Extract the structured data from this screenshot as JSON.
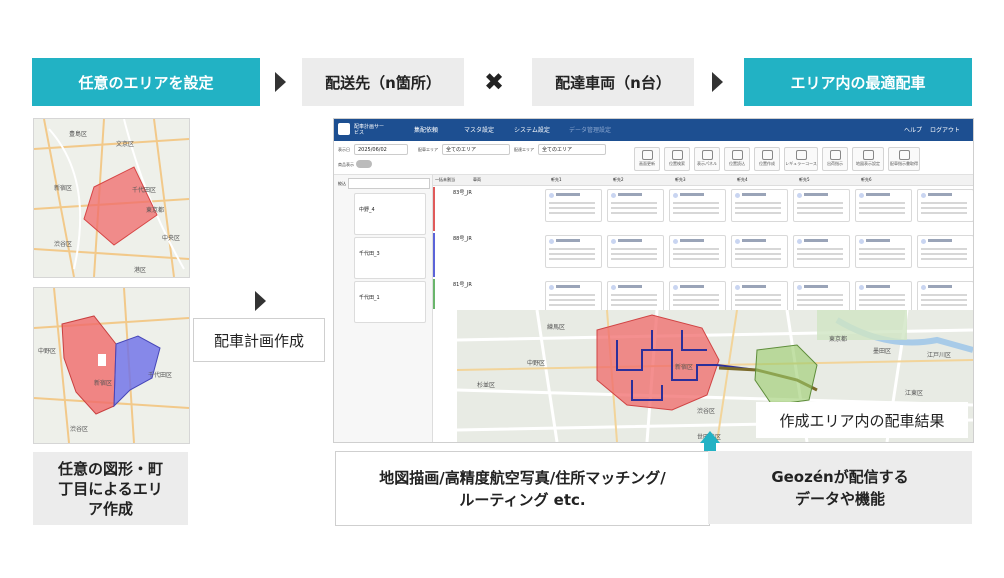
{
  "flow": {
    "step1": "任意のエリアを設定",
    "step2": "配送先（n箇所）",
    "step3": "配達車両（n台）",
    "step4": "エリア内の最適配車",
    "times": "✖"
  },
  "left": {
    "map1_wards": [
      "豊島区",
      "文京区",
      "新宿区",
      "千代田区",
      "東京都",
      "渋谷区",
      "中央区",
      "港区"
    ],
    "map2_wards": [
      "中野区",
      "新宿区",
      "千代田区",
      "渋谷区"
    ],
    "caption": "任意の図形・町丁目によるエリア作成"
  },
  "middle": {
    "plan_label": "配車計画作成"
  },
  "app": {
    "title": "配車計画サービス",
    "menu": [
      "集配依頼",
      "マスタ設定",
      "システム設定",
      "データ管理設定"
    ],
    "help": "ヘルプ",
    "logout": "ログアウト",
    "date_label": "表示日",
    "date_value": "2025/06/02",
    "area_label": "配車エリア",
    "area_value": "全てのエリア",
    "delivery_area_label": "配達エリア",
    "delivery_area_value": "全てのエリア",
    "toggle_label": "商品表示",
    "tools": [
      "画面更新",
      "位置検索",
      "表示パネル",
      "位置読込",
      "位置作成",
      "レギュラーコース",
      "出荷指示",
      "地図表示設定",
      "配車指示書取得"
    ],
    "col_headers": [
      "一括未割当",
      "車両",
      "",
      "軒先1",
      "軒先2",
      "軒先3",
      "軒先4",
      "軒先5",
      "軒先6"
    ],
    "vehicles": [
      "83号_JR",
      "88号_JR",
      "81号_JR"
    ],
    "side_cards": [
      "中野_4",
      "千代田_3",
      "千代田_1"
    ],
    "map_places": [
      "東京都",
      "新宿区",
      "渋谷区",
      "墨田区",
      "江戸川区",
      "江東区",
      "練馬区",
      "中野区",
      "杉並区",
      "世田谷区"
    ]
  },
  "result_label": "作成エリア内の配車結果",
  "bottom": {
    "left_text": "地図描画/高精度航空写真/住所マッチング/ルーティング etc.",
    "right_text": "Geozénが配信するデータや機能"
  }
}
